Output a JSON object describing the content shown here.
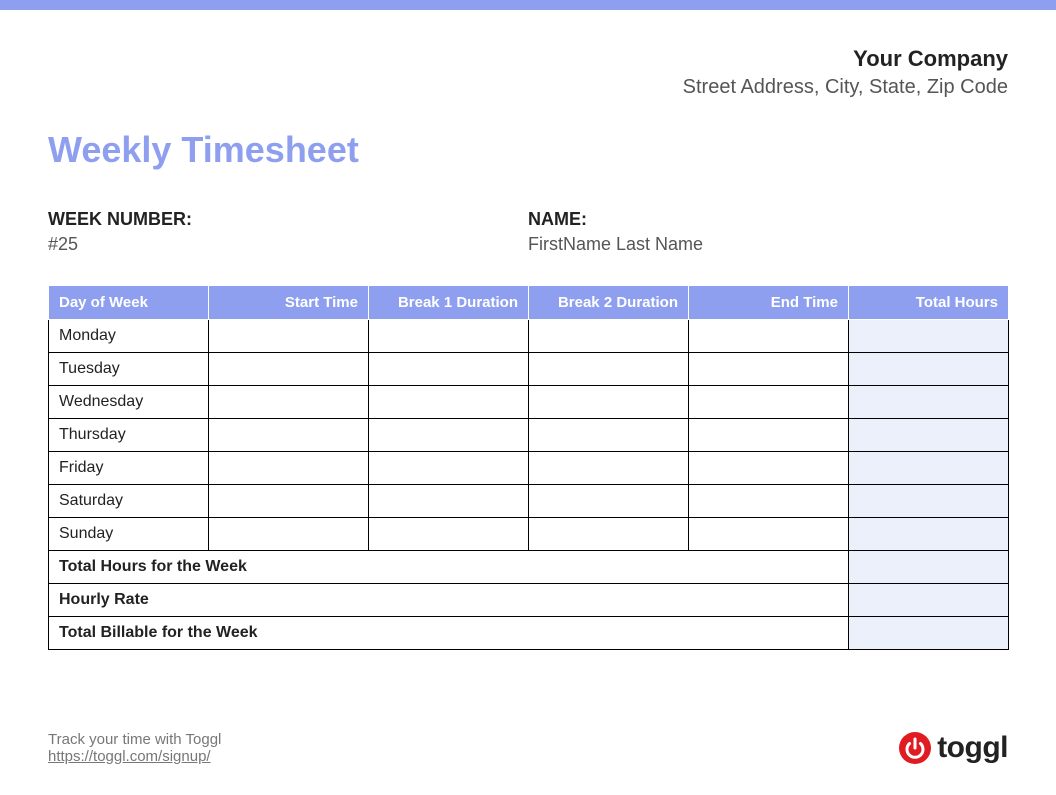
{
  "company": {
    "name": "Your Company",
    "address": "Street Address, City, State, Zip Code"
  },
  "title": "Weekly Timesheet",
  "meta": {
    "week_label": "WEEK NUMBER:",
    "week_value": "#25",
    "name_label": "NAME:",
    "name_value": "FirstName Last Name"
  },
  "table": {
    "headers": {
      "day": "Day of Week",
      "start": "Start Time",
      "break1": "Break 1 Duration",
      "break2": "Break 2 Duration",
      "end": "End Time",
      "total": "Total Hours"
    },
    "rows": [
      {
        "day": "Monday",
        "start": "",
        "break1": "",
        "break2": "",
        "end": "",
        "total": ""
      },
      {
        "day": "Tuesday",
        "start": "",
        "break1": "",
        "break2": "",
        "end": "",
        "total": ""
      },
      {
        "day": "Wednesday",
        "start": "",
        "break1": "",
        "break2": "",
        "end": "",
        "total": ""
      },
      {
        "day": "Thursday",
        "start": "",
        "break1": "",
        "break2": "",
        "end": "",
        "total": ""
      },
      {
        "day": "Friday",
        "start": "",
        "break1": "",
        "break2": "",
        "end": "",
        "total": ""
      },
      {
        "day": "Saturday",
        "start": "",
        "break1": "",
        "break2": "",
        "end": "",
        "total": ""
      },
      {
        "day": "Sunday",
        "start": "",
        "break1": "",
        "break2": "",
        "end": "",
        "total": ""
      }
    ],
    "summary": {
      "total_hours_label": "Total Hours for the Week",
      "total_hours_value": "",
      "hourly_rate_label": "Hourly Rate",
      "hourly_rate_value": "",
      "total_billable_label": "Total Billable for the Week",
      "total_billable_value": ""
    }
  },
  "footer": {
    "text": "Track your time with Toggl",
    "link_text": "https://toggl.com/signup/",
    "logo_text": "toggl"
  },
  "colors": {
    "accent": "#8e9ff0",
    "red": "#e01b22"
  }
}
